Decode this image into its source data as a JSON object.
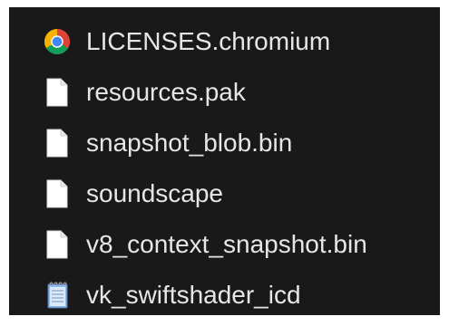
{
  "files": [
    {
      "name": "LICENSES.chromium",
      "icon": "chrome-icon"
    },
    {
      "name": "resources.pak",
      "icon": "file-icon"
    },
    {
      "name": "snapshot_blob.bin",
      "icon": "file-icon"
    },
    {
      "name": "soundscape",
      "icon": "file-icon"
    },
    {
      "name": "v8_context_snapshot.bin",
      "icon": "file-icon"
    },
    {
      "name": "vk_swiftshader_icd",
      "icon": "notepad-icon"
    }
  ],
  "colors": {
    "background": "#191919",
    "text": "#e6e6e6",
    "chrome_red": "#db4437",
    "chrome_yellow": "#f4b400",
    "chrome_green": "#0f9d58",
    "chrome_blue": "#4285f4",
    "notepad_blue": "#8fb7e8"
  }
}
